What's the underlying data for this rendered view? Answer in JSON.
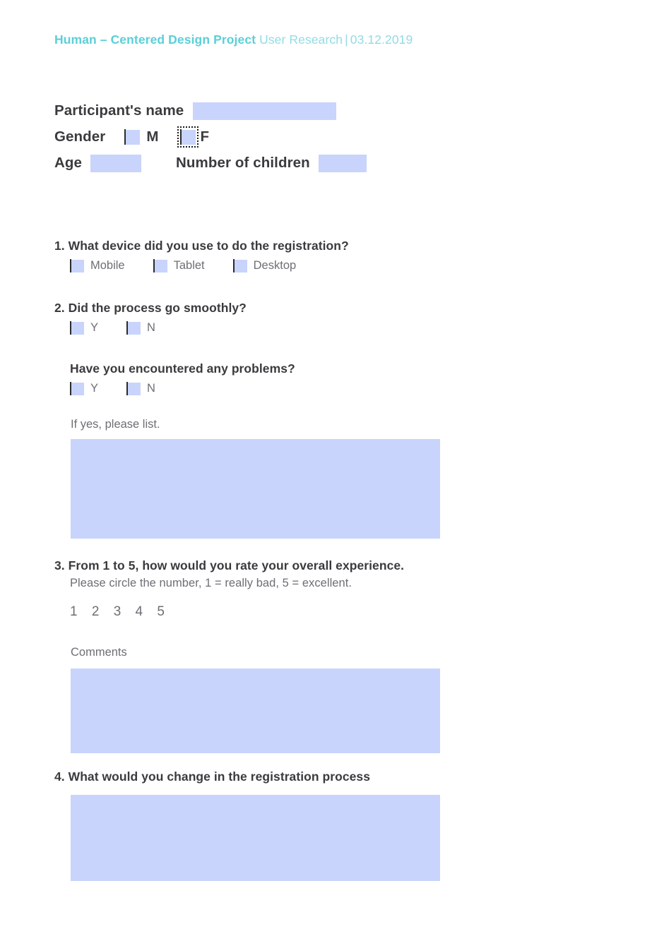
{
  "header": {
    "brand": "Human – Centered Design Project",
    "subtitle": "User Research",
    "separator": "|",
    "date": "03.12.2019"
  },
  "participant": {
    "name_label": "Participant's name",
    "name_value": "",
    "gender_label": "Gender",
    "gender_options": [
      {
        "label": "M",
        "checked": false,
        "selected": false
      },
      {
        "label": "F",
        "checked": false,
        "selected": true
      }
    ],
    "age_label": "Age",
    "age_value": "",
    "children_label": "Number of children",
    "children_value": ""
  },
  "questions": [
    {
      "number": "1.",
      "title": "What device did you use to do the registration?",
      "options": [
        "Mobile",
        "Tablet",
        "Desktop"
      ]
    },
    {
      "number": "2.",
      "title": "Did the process go smoothly?",
      "options": [
        "Y",
        "N"
      ],
      "followup_title": "Have you encountered any problems?",
      "followup_options": [
        "Y",
        "N"
      ],
      "list_label": "If yes, please list.",
      "list_value": ""
    },
    {
      "number": "3.",
      "title": "From 1 to 5, how would you rate your overall experience.",
      "subtitle": "Please circle the number, 1 = really bad, 5 = excellent.",
      "scale": "1  2  3  4  5",
      "comments_label": "Comments",
      "comments_value": ""
    },
    {
      "number": "4.",
      "title": "What would you change in the registration process",
      "answer_value": ""
    }
  ],
  "colors": {
    "brand_teal": "#5bcfd8",
    "subtitle_teal": "#93dbe3",
    "field_fill": "#c8d4fb",
    "heading_text": "#3b3b3f",
    "body_text": "#6e6e75",
    "page_background": "#ffffff"
  }
}
